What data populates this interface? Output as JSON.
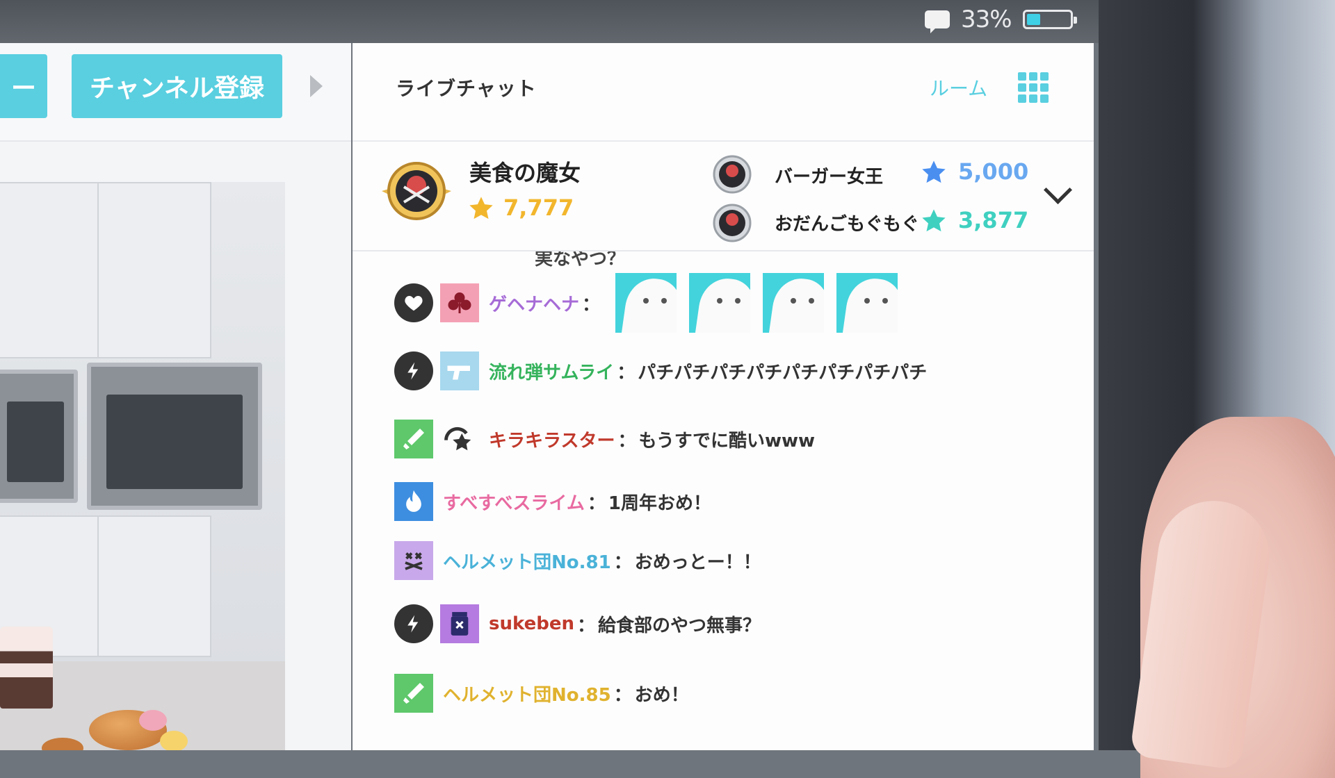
{
  "status_bar": {
    "battery_percent": "33%",
    "battery_level": 0.33
  },
  "left_panel": {
    "partial_button_label": "ー",
    "subscribe_button_label": "チャンネル登録"
  },
  "chat": {
    "title": "ライブチャット",
    "room_label": "ルーム",
    "ranking": {
      "top": {
        "name": "美食の魔女",
        "points": "7,777"
      },
      "others": [
        {
          "name": "バーガー女王",
          "points": "5,000",
          "star_color": "#4a8ff0",
          "points_color": "#69a8f0"
        },
        {
          "name": "おだんごもぐもぐ",
          "points": "3,877",
          "star_color": "#3fd0c0",
          "points_color": "#3fd0c0"
        }
      ]
    },
    "cutoff_text": "実なやつ？",
    "messages": [
      {
        "badge": "heart-icon",
        "avatar": "club-icon",
        "user": "ゲヘナヘナ",
        "user_color": "#a66bd6",
        "separator": "：",
        "text": "",
        "stickers": 4
      },
      {
        "badge": "lightning-icon",
        "avatar": "gun-icon",
        "user": "流れ弾サムライ",
        "user_color": "#35b35c",
        "separator": "：",
        "text": "パチパチパチパチパチパチパチパチ"
      },
      {
        "badge": "sword-icon",
        "avatar": "star-swirl-icon",
        "user": "キラキラスター",
        "user_color": "#c0392b",
        "separator": "：",
        "text": "もうすでに酷いwww"
      },
      {
        "badge": "flame-icon",
        "avatar": "",
        "user": "すべすべスライム",
        "user_color": "#e86aa0",
        "separator": "：",
        "text": "1周年おめ！"
      },
      {
        "badge": "cross-face-icon",
        "avatar": "",
        "user": "ヘルメット団No.81",
        "user_color": "#4ab2d8",
        "separator": "：",
        "text": "おめっとー！！"
      },
      {
        "badge": "lightning-icon",
        "avatar": "jar-icon",
        "user": "sukeben",
        "user_color": "#c0392b",
        "separator": "：",
        "text": "給食部のやつ無事？"
      },
      {
        "badge": "sword-icon",
        "avatar": "",
        "user": "ヘルメット団No.85",
        "user_color": "#e0b22e",
        "separator": "：",
        "text": "おめ！"
      }
    ]
  }
}
